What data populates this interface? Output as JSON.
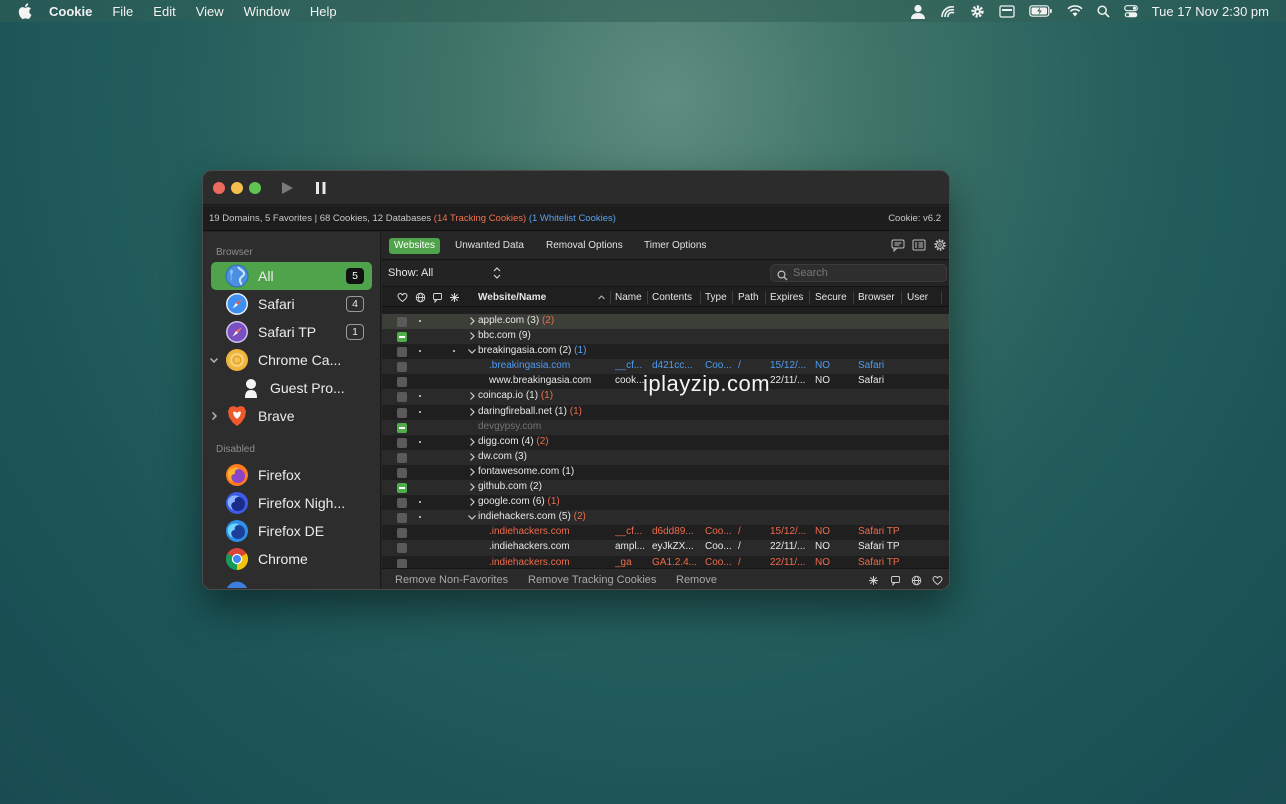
{
  "menubar": {
    "app_name": "Cookie",
    "menus": [
      "File",
      "Edit",
      "View",
      "Window",
      "Help"
    ],
    "clock": "Tue 17 Nov  2:30 pm",
    "icons": [
      "user-icon",
      "airdrop-icon",
      "gear-icon",
      "keyboard-icon",
      "battery-icon",
      "wifi-icon",
      "search-icon",
      "control-center-icon"
    ]
  },
  "window": {
    "status": {
      "summary": "19 Domains, 5 Favorites | 68 Cookies, 12 Databases",
      "tracking": "(14 Tracking Cookies)",
      "whitelist": "(1 Whitelist Cookies)",
      "version": "Cookie: v6.2"
    },
    "sidebar": {
      "browser_heading": "Browser",
      "disabled_heading": "Disabled",
      "browsers": [
        {
          "label": "All",
          "badge": "5",
          "icon": "globe-icon"
        },
        {
          "label": "Safari",
          "badge": "4",
          "icon": "safari-icon"
        },
        {
          "label": "Safari TP",
          "badge": "1",
          "icon": "safari-tp-icon"
        },
        {
          "label": "Chrome Ca...",
          "badge": "",
          "icon": "chrome-canary-icon"
        },
        {
          "label": "Guest Pro...",
          "badge": "",
          "icon": "person-icon"
        },
        {
          "label": "Brave",
          "badge": "",
          "icon": "brave-icon"
        }
      ],
      "disabled": [
        {
          "label": "Firefox",
          "icon": "firefox-icon"
        },
        {
          "label": "Firefox Nigh...",
          "icon": "firefox-nightly-icon"
        },
        {
          "label": "Firefox DE",
          "icon": "firefox-de-icon"
        },
        {
          "label": "Chrome",
          "icon": "chrome-icon"
        }
      ]
    },
    "tabs": [
      "Websites",
      "Unwanted Data",
      "Removal Options",
      "Timer Options"
    ],
    "filter": {
      "show_label": "Show: All",
      "search_placeholder": "Search"
    },
    "columns": {
      "website": "Website/Name",
      "name": "Name",
      "contents": "Contents",
      "type": "Type",
      "path": "Path",
      "expires": "Expires",
      "secure": "Secure",
      "browser": "Browser",
      "user": "User"
    },
    "rows": [
      {
        "site": "apple.com",
        "count": "(3)",
        "extra": "(2)",
        "extra_color": "orange"
      },
      {
        "site": "bbc.com",
        "count": "(9)",
        "extra": "",
        "extra_color": ""
      },
      {
        "site": "breakingasia.com",
        "count": "(2)",
        "extra": "(1)",
        "extra_color": "blue"
      },
      {
        "site": ".breakingasia.com",
        "name": "__cf...",
        "contents": "d421cc...",
        "type": "Coo...",
        "path": "/",
        "expires": "15/12/...",
        "secure": "NO",
        "browser": "Safari"
      },
      {
        "site": "www.breakingasia.com",
        "name": "cook...",
        "contents": "",
        "type": "",
        "path": "",
        "expires": "22/11/...",
        "secure": "NO",
        "browser": "Safari"
      },
      {
        "site": "coincap.io",
        "count": "(1)",
        "extra": "(1)",
        "extra_color": "orange"
      },
      {
        "site": "daringfireball.net",
        "count": "(1)",
        "extra": "(1)",
        "extra_color": "orange"
      },
      {
        "site": "devgypsy.com",
        "count": "",
        "extra": "",
        "extra_color": ""
      },
      {
        "site": "digg.com",
        "count": "(4)",
        "extra": "(2)",
        "extra_color": "orange"
      },
      {
        "site": "dw.com",
        "count": "(3)",
        "extra": "",
        "extra_color": ""
      },
      {
        "site": "fontawesome.com",
        "count": "(1)",
        "extra": "",
        "extra_color": ""
      },
      {
        "site": "github.com",
        "count": "(2)",
        "extra": "",
        "extra_color": ""
      },
      {
        "site": "google.com",
        "count": "(6)",
        "extra": "(1)",
        "extra_color": "orange"
      },
      {
        "site": "indiehackers.com",
        "count": "(5)",
        "extra": "(2)",
        "extra_color": "orange"
      },
      {
        "site": ".indiehackers.com",
        "name": "__cf...",
        "contents": "d6dd89...",
        "type": "Coo...",
        "path": "/",
        "expires": "15/12/...",
        "secure": "NO",
        "browser": "Safari TP"
      },
      {
        "site": ".indiehackers.com",
        "name": "ampl...",
        "contents": "eyJkZX...",
        "type": "Coo...",
        "path": "/",
        "expires": "22/11/...",
        "secure": "NO",
        "browser": "Safari TP"
      },
      {
        "site": ".indiehackers.com",
        "name": "_ga",
        "contents": "GA1.2.4...",
        "type": "Coo...",
        "path": "/",
        "expires": "22/11/...",
        "secure": "NO",
        "browser": "Safari TP"
      }
    ],
    "footer": {
      "remove_non_favorites": "Remove Non-Favorites",
      "remove_tracking": "Remove Tracking Cookies",
      "remove": "Remove"
    }
  },
  "watermark": "iplayzip.com",
  "colors": {
    "accent_green": "#4fa34a",
    "tracking_orange": "#f06b4b",
    "whitelist_blue": "#5aa2f0"
  }
}
